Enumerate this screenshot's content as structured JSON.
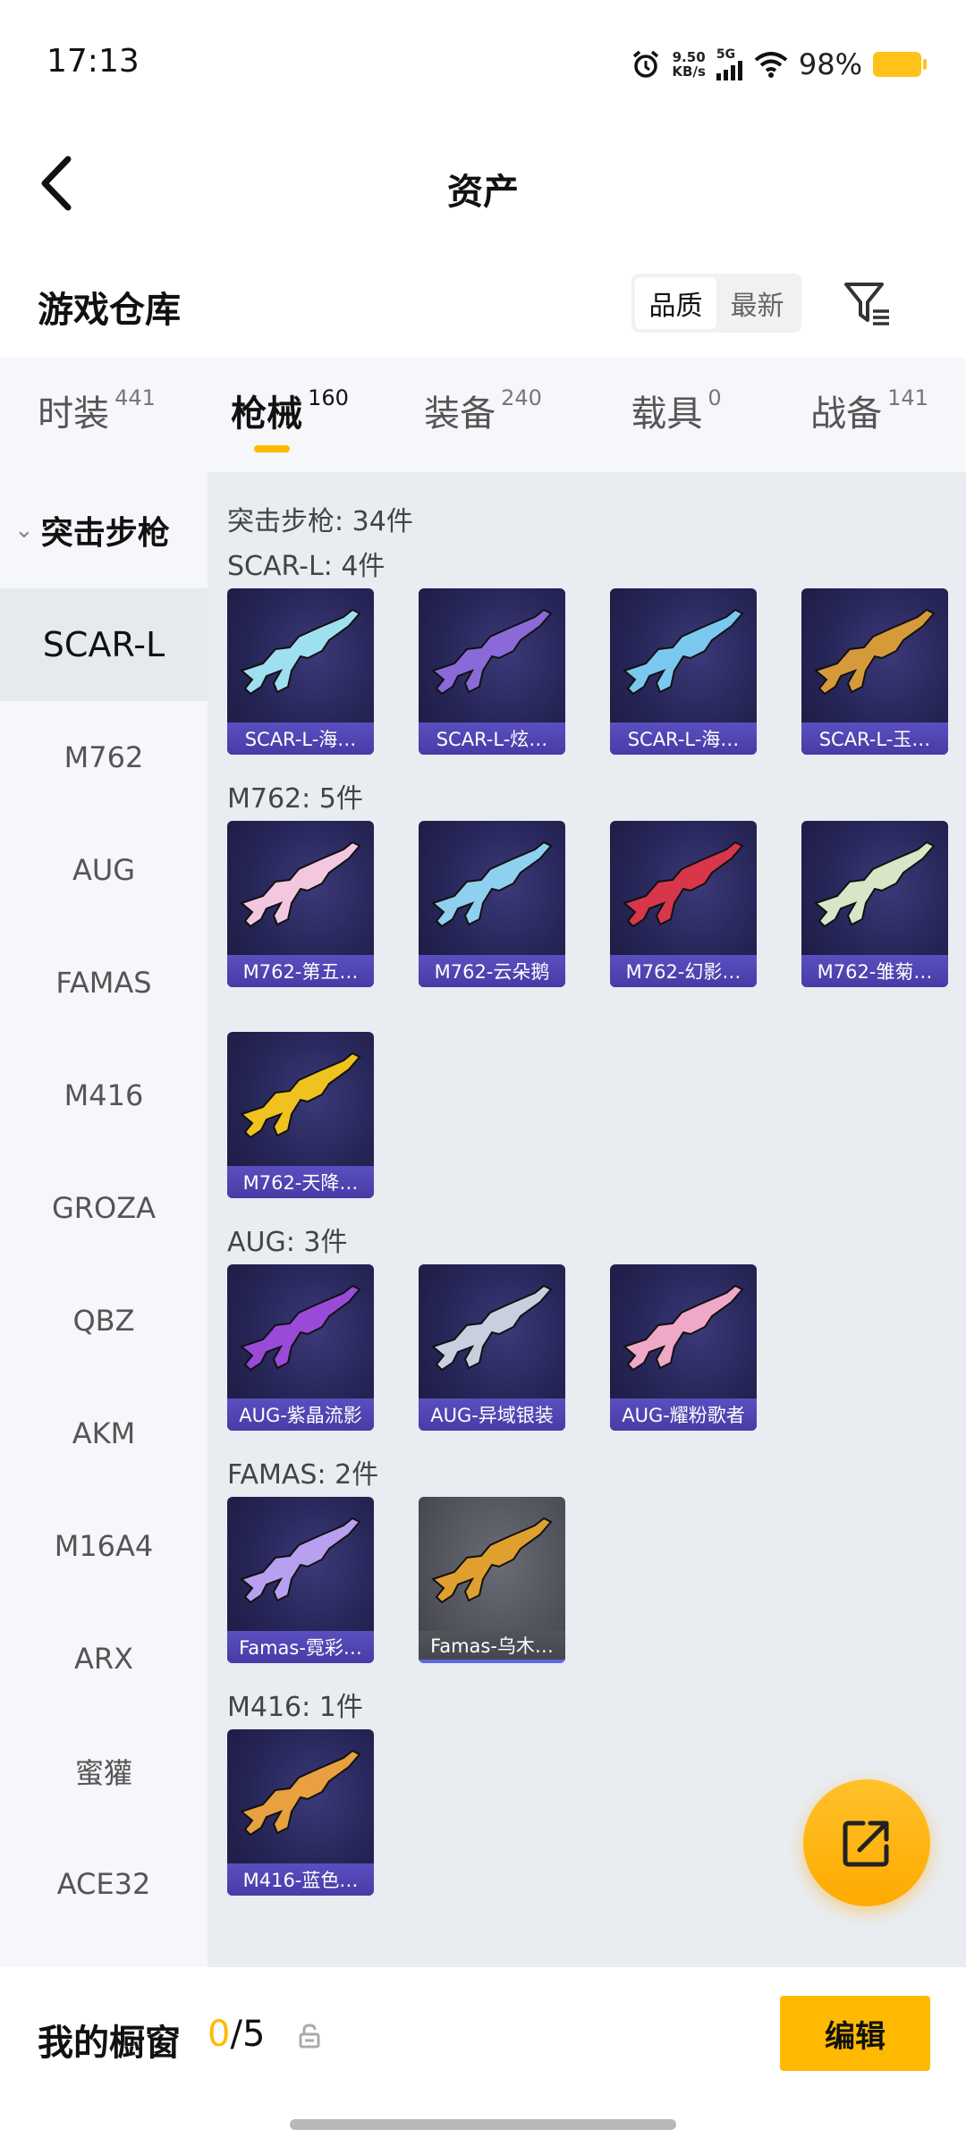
{
  "status_bar": {
    "time": "17:13",
    "net_speed": "9.50",
    "net_unit": "KB/s",
    "network_type": "5G",
    "battery": "98%",
    "icons": [
      "alarm-icon",
      "signal-icon",
      "wifi-icon",
      "battery-icon"
    ],
    "battery_color": "#ffc21a"
  },
  "header": {
    "title": "资产",
    "back_icon": "chevron-left-icon"
  },
  "warehouse": {
    "title": "游戏仓库",
    "sort": {
      "options": [
        "品质",
        "最新"
      ],
      "selected": "品质"
    },
    "filter_icon": "filter-icon"
  },
  "tabs": [
    {
      "label": "时装",
      "count": "441"
    },
    {
      "label": "枪械",
      "count": "160",
      "active": true
    },
    {
      "label": "装备",
      "count": "240"
    },
    {
      "label": "载具",
      "count": "0"
    },
    {
      "label": "战备",
      "count": "141"
    }
  ],
  "sidebar": {
    "category": "突击步枪",
    "items": [
      "SCAR-L",
      "M762",
      "AUG",
      "FAMAS",
      "M416",
      "GROZA",
      "QBZ",
      "AKM",
      "M16A4",
      "ARX",
      "蜜獾",
      "ACE32"
    ],
    "selected": "SCAR-L"
  },
  "content": {
    "total": "突击步枪: 34件",
    "groups": [
      {
        "label": "SCAR-L: 4件",
        "items": [
          {
            "name": "SCAR-L-海…",
            "color": "#9fe0f0"
          },
          {
            "name": "SCAR-L-炫…",
            "color": "#8a6ad8"
          },
          {
            "name": "SCAR-L-海…",
            "color": "#7ac8f0"
          },
          {
            "name": "SCAR-L-玉…",
            "color": "#d79a3a"
          }
        ]
      },
      {
        "label": "M762: 5件",
        "items": [
          {
            "name": "M762-第五…",
            "color": "#f4c7e0"
          },
          {
            "name": "M762-云朵鹅",
            "color": "#8fd0f0"
          },
          {
            "name": "M762-幻影…",
            "color": "#d8364a"
          },
          {
            "name": "M762-雏菊…",
            "color": "#d8e6c8"
          },
          {
            "name": "M762-天降…",
            "color": "#f0c220"
          }
        ]
      },
      {
        "label": "AUG: 3件",
        "items": [
          {
            "name": "AUG-紫晶流影",
            "color": "#9a4ad8"
          },
          {
            "name": "AUG-异域银装",
            "color": "#c8d0e0"
          },
          {
            "name": "AUG-耀粉歌者",
            "color": "#f0a8c8"
          }
        ]
      },
      {
        "label": "FAMAS: 2件",
        "items": [
          {
            "name": "Famas-霓彩…",
            "color": "#b8a0f0"
          },
          {
            "name": "Famas-乌木…",
            "color": "#e0a030",
            "grey": true
          }
        ]
      },
      {
        "label": "M416: 1件",
        "items": [
          {
            "name": "M416-蓝色…",
            "color": "#e8a040"
          }
        ]
      }
    ]
  },
  "fab": {
    "icon": "share-export-icon"
  },
  "bottom_bar": {
    "title": "我的橱窗",
    "current": "0",
    "separator": "/",
    "max": "5",
    "lock_icon": "lock-icon",
    "edit_label": "编辑"
  },
  "accent_color": "#ffb900"
}
